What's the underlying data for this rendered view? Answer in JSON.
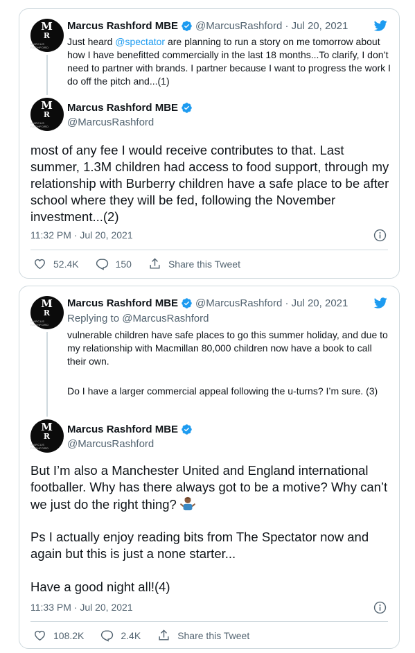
{
  "colors": {
    "brand": "#1d9bf0",
    "text": "#0f1419",
    "muted": "#536471",
    "border": "#cfd9de"
  },
  "tweet1": {
    "quoted": {
      "name": "Marcus Rashford MBE",
      "meta": "@MarcusRashford · Jul 20, 2021",
      "text_pre": "Just heard ",
      "mention": "@spectator",
      "text_post": " are planning to run a story on me tomorrow about how I have benefitted commercially in the last 18 months...To clarify, I don’t need to partner with brands. I partner because I want to progress the work I do off the pitch and...(1)"
    },
    "main": {
      "name": "Marcus Rashford MBE",
      "handle": "@MarcusRashford",
      "text": "most of any fee I would receive contributes to that. Last summer, 1.3M children had access to food support, through my relationship with Burberry children have a safe place to be after school where they will be fed, following the November investment...(2)",
      "timestamp": "11:32 PM · Jul 20, 2021",
      "likes": "52.4K",
      "replies": "150",
      "share_label": "Share this Tweet"
    }
  },
  "tweet2": {
    "quoted": {
      "name": "Marcus Rashford MBE",
      "meta": "@MarcusRashford · Jul 20, 2021",
      "replying": "Replying to @MarcusRashford",
      "para1": "vulnerable children have safe places to go this summer holiday, and due to my relationship with Macmillan 80,000 children now have a book to call their own.",
      "para2": "Do I have a larger commercial appeal following the u-turns? I’m sure. (3)"
    },
    "main": {
      "name": "Marcus Rashford MBE",
      "handle": "@MarcusRashford",
      "para1": "But I’m also a Manchester United and England international footballer. Why has there always got to be a motive? Why can’t we just do the right thing?",
      "emoji": "person-shrugging",
      "para2": "Ps I actually enjoy reading bits from The Spectator now and again but this is just a none starter...",
      "para3": "Have a good night all!(4)",
      "timestamp": "11:33 PM · Jul 20, 2021",
      "likes": "108.2K",
      "replies": "2.4K",
      "share_label": "Share this Tweet"
    }
  },
  "icons": {
    "verified": "verified-badge-icon",
    "bird": "twitter-bird-icon",
    "info": "info-icon",
    "like": "heart-icon",
    "reply": "reply-bubble-icon",
    "share": "share-icon"
  }
}
